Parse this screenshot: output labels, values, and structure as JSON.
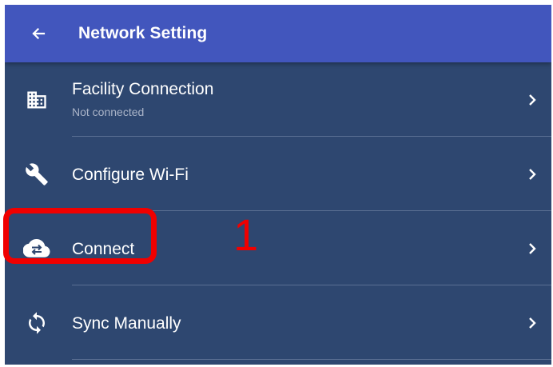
{
  "header": {
    "back_icon": "arrow-left-icon",
    "title": "Network Setting"
  },
  "items": [
    {
      "label": "Facility Connection",
      "subtitle": "Not connected",
      "icon": "building-icon"
    },
    {
      "label": "Configure Wi-Fi",
      "icon": "wrench-icon"
    },
    {
      "label": "Connect",
      "icon": "cloud-sync-icon"
    },
    {
      "label": "Sync Manually",
      "icon": "sync-icon"
    }
  ],
  "annotation": {
    "step_number": "1",
    "color": "#f00000"
  },
  "colors": {
    "appbar": "#4256bd",
    "background": "#2e4770",
    "text": "#ffffff"
  }
}
